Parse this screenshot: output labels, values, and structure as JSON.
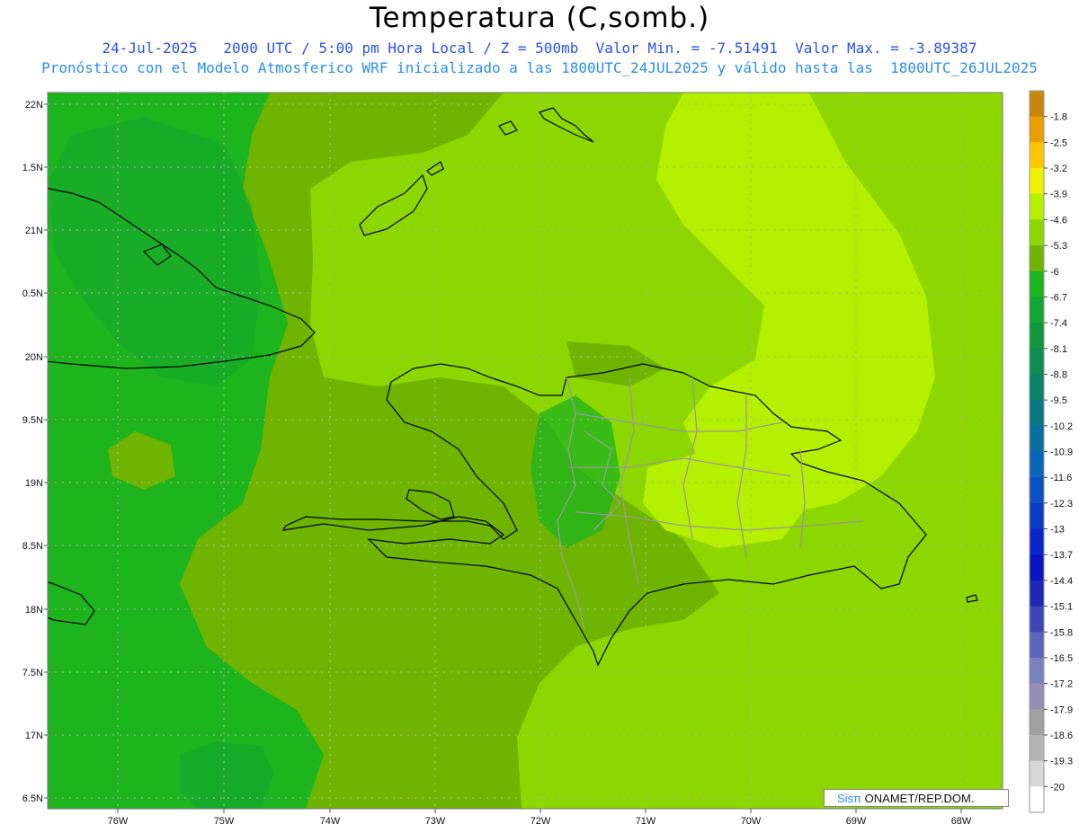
{
  "header": {
    "title": "Temperatura (C,somb.)",
    "line1": "24-Jul-2025   2000 UTC / 5:00 pm Hora Local / Z = 500mb  Valor Min. = -7.51491  Valor Max. = -3.89387",
    "line2": "Pronóstico con el Modelo Atmosferico WRF inicializado a las 1800UTC_24JUL2025 y válido hasta las  1800UTC_26JUL2025"
  },
  "axes": {
    "lat_labels": [
      "22N",
      "1.5N",
      "21N",
      "0.5N",
      "20N",
      "9.5N",
      "19N",
      "8.5N",
      "18N",
      "7.5N",
      "17N",
      "6.5N"
    ],
    "lon_labels": [
      "76W",
      "75W",
      "74W",
      "73W",
      "72W",
      "71W",
      "70W",
      "69W",
      "68W"
    ]
  },
  "colorbar": {
    "labels": [
      "-1.8",
      "-2.5",
      "-3.2",
      "-3.9",
      "-4.6",
      "-5.3",
      "-6",
      "-6.7",
      "-7.4",
      "-8.1",
      "-8.8",
      "-9.5",
      "-10.2",
      "-10.9",
      "-11.6",
      "-12.3",
      "-13",
      "-13.7",
      "-14.4",
      "-15.1",
      "-15.8",
      "-16.5",
      "-17.2",
      "-17.9",
      "-18.6",
      "-19.3",
      "-20"
    ],
    "colors": [
      "#c8860a",
      "#e8a000",
      "#ffc800",
      "#f0f000",
      "#b4f000",
      "#8cd700",
      "#6eb400",
      "#1eb41e",
      "#14a532",
      "#12963c",
      "#0f8c50",
      "#0c8264",
      "#0a7882",
      "#0a6ea0",
      "#0a64b9",
      "#0a50c3",
      "#0a3cc8",
      "#0a28c8",
      "#0a14c3",
      "#1e28b4",
      "#3c46b4",
      "#5a64b9",
      "#7882be",
      "#968cb4",
      "#a0a0a0",
      "#b4b4b4",
      "#d7d7d7",
      "#ffffff"
    ]
  },
  "credit": {
    "logo": "Sisπ",
    "text": " ONAMET/REP.DOM."
  }
}
